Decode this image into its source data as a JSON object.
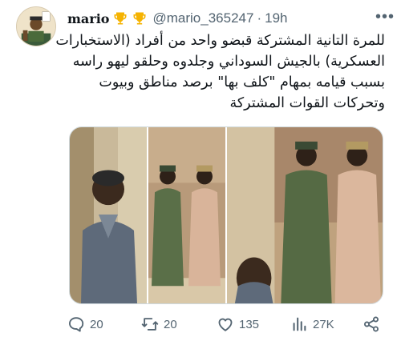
{
  "tweet": {
    "author_name": "mario",
    "handle": "@mario_365247",
    "separator": "·",
    "time": "19h",
    "text_lines": [
      "للمرة التانية المشتركة قبضو واحد من أفراد (الاستخبارات",
      "العسكرية) بالجيش السوداني وجلدوه وحلقو ليهو راسه",
      "بسبب قيامه بمهام \"كلف بها\" برصد مناطق وبيوت",
      "وتحركات القوات المشتركة"
    ],
    "more_label": "•••"
  },
  "icons": {
    "badge_1": "trophy-icon",
    "badge_2": "trophy-icon",
    "more": "more-icon",
    "reply": "reply-icon",
    "retweet": "retweet-icon",
    "like": "heart-icon",
    "views": "views-icon",
    "share": "share-icon"
  },
  "actions": {
    "replies": "20",
    "retweets": "20",
    "likes": "135",
    "views": "27K"
  },
  "colors": {
    "text": "#0f1419",
    "secondary": "#536471",
    "border": "#cfd9de",
    "trophy": "#f5b301"
  }
}
